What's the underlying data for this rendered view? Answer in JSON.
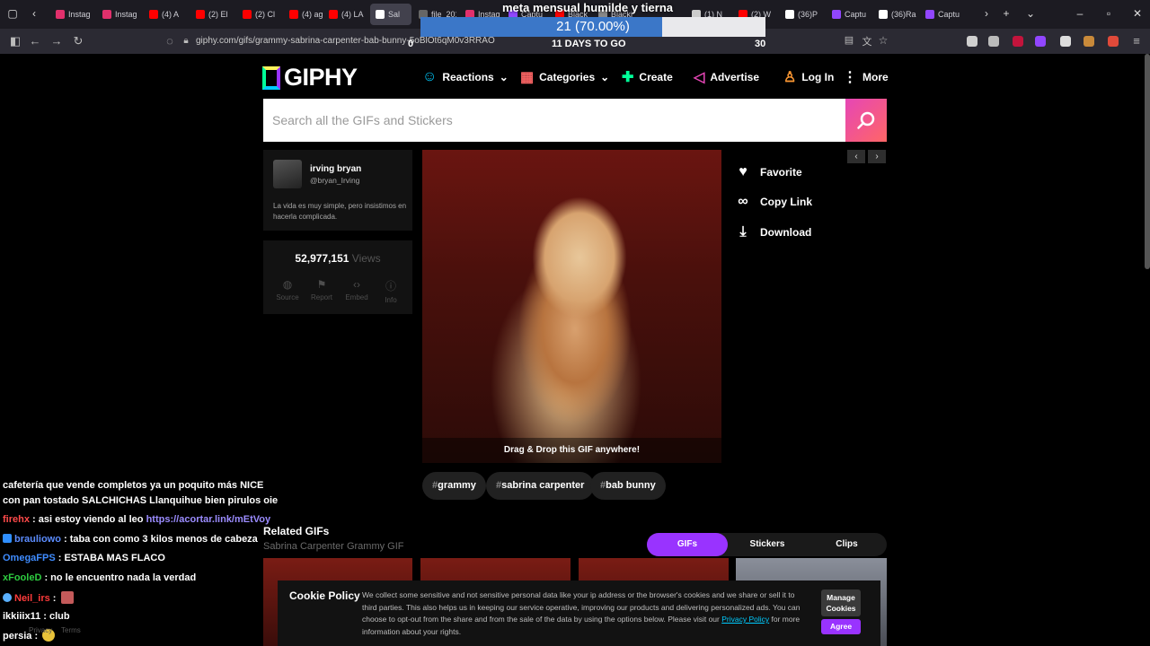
{
  "browser": {
    "tabs": [
      {
        "label": "Instag",
        "color": "#e1306c"
      },
      {
        "label": "Instag",
        "color": "#e1306c"
      },
      {
        "label": "(4) A",
        "color": "#ff0000"
      },
      {
        "label": "(2) El",
        "color": "#ff0000"
      },
      {
        "label": "(2) Cl",
        "color": "#ff0000"
      },
      {
        "label": "(4) ag",
        "color": "#ff0000"
      },
      {
        "label": "(4) LA",
        "color": "#ff0000"
      },
      {
        "label": "Sal",
        "color": "#ffffff"
      },
      {
        "label": "file_2012",
        "color": "#666666"
      },
      {
        "label": "Instag",
        "color": "#e1306c"
      },
      {
        "label": "Captu",
        "color": "#9146ff"
      },
      {
        "label": "Black",
        "color": "#ff0000"
      },
      {
        "label": "Blacki",
        "color": "#888888"
      },
      {
        "label": "(1) N",
        "color": "#cccccc"
      },
      {
        "label": "(2) W",
        "color": "#ff0000"
      },
      {
        "label": "(36)P",
        "color": "#ffffff"
      },
      {
        "label": "Captu",
        "color": "#9146ff"
      },
      {
        "label": "(36)Ra",
        "color": "#ffffff"
      },
      {
        "label": "Captu",
        "color": "#9146ff"
      }
    ],
    "url": "giphy.com/gifs/grammy-sabrina-carpenter-bab-bunny-5oBlOt6qM0v3RRAO"
  },
  "goal": {
    "title": "meta mensual humilde y tierna",
    "progress_text": "21 (70.00%)",
    "progress_fraction": 0.7,
    "days_left": "11 DAYS TO GO",
    "min": "0",
    "max": "30"
  },
  "header": {
    "logo": "GIPHY",
    "nav": [
      {
        "label": "Reactions",
        "icon": "smiley-icon",
        "color": "#00ccff"
      },
      {
        "label": "Categories",
        "icon": "grid-icon",
        "color": "#ff6666"
      },
      {
        "label": "Create",
        "icon": "plus-icon",
        "color": "#00ff99"
      },
      {
        "label": "Advertise",
        "icon": "megaphone-icon",
        "color": "#e646b6"
      },
      {
        "label": "Log In",
        "icon": "user-icon",
        "color": "#ff9933"
      },
      {
        "label": "More",
        "icon": "vertical-dots-icon",
        "color": "#ffffff"
      }
    ]
  },
  "search": {
    "placeholder": "Search all the GIFs and Stickers"
  },
  "user": {
    "name": "irving  bryan",
    "handle": "@bryan_Irving",
    "bio": "La vida es muy simple, pero insistimos en hacerla complicada."
  },
  "stats": {
    "views": "52,977,151",
    "views_label": "Views",
    "actions": [
      "Source",
      "Report",
      "Embed",
      "Info"
    ]
  },
  "gif": {
    "caption": "Drag & Drop this GIF anywhere!"
  },
  "actions": {
    "favorite": "Favorite",
    "copy_link": "Copy Link",
    "download": "Download"
  },
  "tags": [
    {
      "hash": "#",
      "label": "grammy"
    },
    {
      "hash": "#",
      "label": "sabrina carpenter"
    },
    {
      "hash": "#",
      "label": "bab bunny"
    }
  ],
  "related": {
    "title": "Related GIFs",
    "subtitle": "Sabrina Carpenter Grammy GIF",
    "tabs": [
      "GIFs",
      "Stickers",
      "Clips"
    ],
    "active_tab": "GIFs"
  },
  "cookie": {
    "title": "Cookie Policy",
    "text_before": "We collect some sensitive and not sensitive personal data like your ip address or the browser's cookies and we share or sell it to third parties. This also helps us in keeping our service operative, improving our products and delivering personalized ads. You can choose to opt-out from the share and from the sale of the data by using the options below. Please visit our ",
    "link": "Privacy Policy",
    "text_after": " for more information about your rights.",
    "manage": "Manage Cookies",
    "agree": "Agree"
  },
  "chat": [
    {
      "user": "",
      "color": "#ffffff",
      "text": "cafetería que vende completos ya un poquito más NICE"
    },
    {
      "user": "",
      "color": "#ffffff",
      "text": "con pan tostado SALCHICHAS Llanquihue bien pirulos oie"
    },
    {
      "user": "firehx",
      "color": "#ff4a4a",
      "text": " : asi estoy viendo al leo ",
      "link": "https://acortar.link/mEtVoy"
    },
    {
      "user": "brauliowo",
      "color": "#5b8cff",
      "text": " : taba con como 3 kilos menos de cabeza"
    },
    {
      "user": "OmegaFPS",
      "color": "#3f8cff",
      "text": " : ESTABA MAS FLACO"
    },
    {
      "user": "xFooleD",
      "color": "#2ecc40",
      "text": " : no le encuentro nada la verdad"
    },
    {
      "user": "Neil_irs",
      "color": "#ff3b3b",
      "text": " : "
    },
    {
      "user": "ikkiiix11",
      "color": "#ffffff",
      "text": " : club"
    },
    {
      "user": "persia",
      "color": "#ffffff",
      "text": " : "
    }
  ],
  "footer": {
    "privacy": "Privacy",
    "terms": "Terms"
  }
}
